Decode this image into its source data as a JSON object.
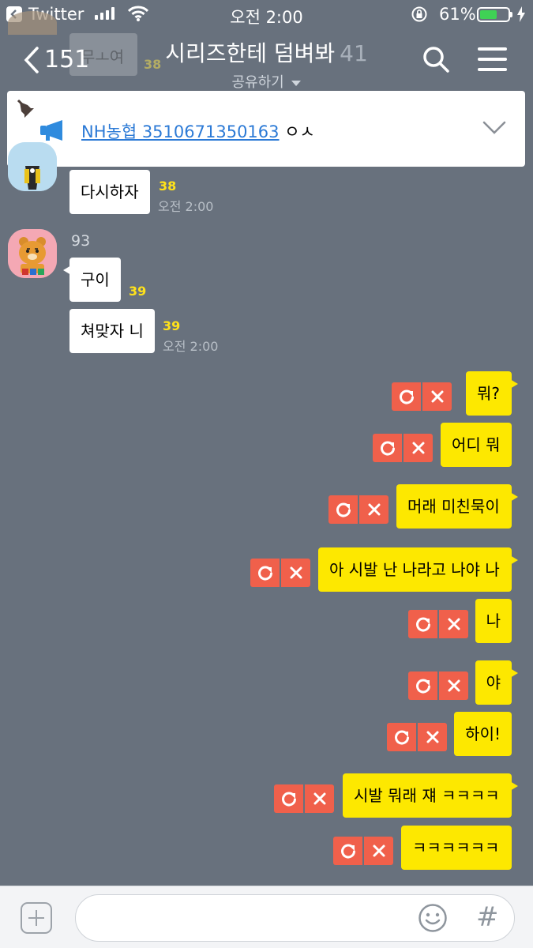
{
  "status_bar": {
    "back_app": "Twitter",
    "time": "오전 2:00",
    "battery_percent": "61%",
    "battery_level": 0.61
  },
  "header": {
    "back_count": "151",
    "title": "시리즈한테 덤벼봐",
    "member_count": "41",
    "subtitle": "공유하기"
  },
  "ghost_message": {
    "text": "무ㅗ여",
    "unread": "38"
  },
  "notice": {
    "link_text": "NH농협 3510671350163",
    "suffix": " ㅇㅅ"
  },
  "incoming": [
    {
      "text": "다시하자",
      "unread": "38",
      "time": "오전 2:00"
    },
    {
      "sender": "93",
      "text": "구이",
      "unread": "39"
    },
    {
      "text": "쳐맞자 니",
      "unread": "39",
      "time": "오전 2:00"
    }
  ],
  "outgoing": [
    {
      "text": "뭐?"
    },
    {
      "text": "어디 뭐"
    },
    {
      "text": "머래 미친묵이"
    },
    {
      "text": "아 시발 난 나라고 나야 나"
    },
    {
      "text": "나"
    },
    {
      "text": "야"
    },
    {
      "text": "하이!"
    },
    {
      "text": "시발 뭐래 쟤 ㅋㅋㅋㅋ"
    },
    {
      "text": "ㅋㅋㅋㅋㅋㅋ"
    }
  ],
  "input": {
    "value": "",
    "placeholder": ""
  },
  "colors": {
    "chat_background": "#68717d",
    "my_bubble": "#fde800",
    "other_bubble": "#ffffff",
    "unread_count": "#ffe21a",
    "failed_action": "#f0604b",
    "notice_link": "#2c7ad6"
  },
  "icons": {
    "back": "chevron-left-icon",
    "search": "search-icon",
    "menu": "hamburger-menu-icon",
    "pin": "pin-icon",
    "notice": "megaphone-icon",
    "expand": "chevron-down-icon",
    "retry": "retry-icon",
    "delete": "close-icon",
    "attach": "plus-icon",
    "emoji": "emoji-icon",
    "hashtag": "hash-icon"
  }
}
